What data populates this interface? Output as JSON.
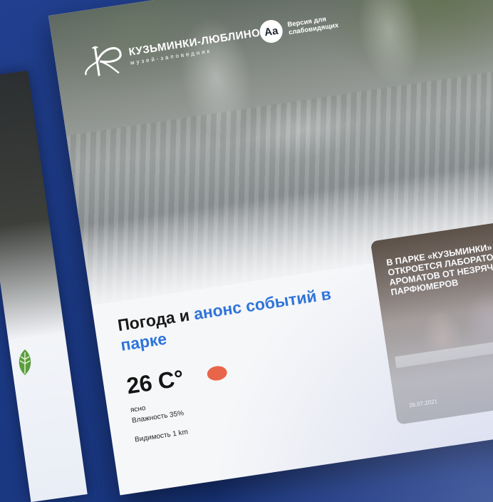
{
  "header": {
    "logo_name": "КУЗЬМИНКИ-ЛЮБЛИНО",
    "logo_sub": "музей-заповедник",
    "a11y_icon": "Аа",
    "a11y_label": "Версия для слабовидящих"
  },
  "weather": {
    "title_prefix": "Погода и",
    "title_accent": "анонс событий в парке",
    "temperature": "26 C°",
    "condition": "ясно",
    "humidity": "Влажность 35%",
    "visibility": "Видимость 1 km",
    "icon_color": "#e9654a",
    "icon": "sun-icon"
  },
  "news": {
    "headline": "В ПАРКЕ «КУЗЬМИНКИ» ОТКРОЕТСЯ ЛАБОРАТОРИЯ АРОМАТОВ ОТ НЕЗРЯЧИХ ПАРФЮМЕРОВ",
    "date": "26.07.2021"
  },
  "colors": {
    "background": "#1f3c8a",
    "accent": "#2f74d9"
  }
}
